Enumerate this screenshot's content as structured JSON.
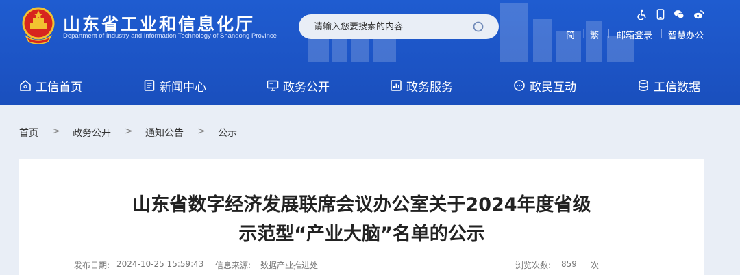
{
  "header": {
    "site_title": "山东省工业和信息化厅",
    "site_subtitle": "Department of Industry and Information Technology of Shandong Province",
    "search": {
      "placeholder": "请输入您要搜索的内容"
    },
    "tool_icons": [
      "accessibility-icon",
      "mobile-icon",
      "wechat-icon",
      "weibo-icon"
    ],
    "util_links": {
      "simplified": "简",
      "traditional": "繁",
      "mail_login": "邮箱登录",
      "smart_office": "智慧办公",
      "separator": "|"
    }
  },
  "nav": {
    "items": [
      {
        "label": "工信首页",
        "icon": "home-icon"
      },
      {
        "label": "新闻中心",
        "icon": "news-icon"
      },
      {
        "label": "政务公开",
        "icon": "monitor-icon"
      },
      {
        "label": "政务服务",
        "icon": "service-icon"
      },
      {
        "label": "政民互动",
        "icon": "chat-icon"
      },
      {
        "label": "工信数据",
        "icon": "database-icon"
      }
    ]
  },
  "breadcrumb": {
    "items": [
      "首页",
      "政务公开",
      "通知公告",
      "公示"
    ],
    "separator": ">"
  },
  "article": {
    "title_line1": "山东省数字经济发展联席会议办公室关于2024年度省级",
    "title_line2": "示范型“产业大脑”名单的公示",
    "publish_label": "发布日期:",
    "publish_date": "2024-10-25 15:59:43",
    "source_label": "信息来源:",
    "source": "数据产业推进处",
    "views_label": "浏览次数:",
    "views": "859",
    "views_unit": "次"
  },
  "colors": {
    "header_blue": "#1d56c8",
    "page_bg": "#e9eef6",
    "card_bg": "#ffffff",
    "title_text": "#222222"
  }
}
